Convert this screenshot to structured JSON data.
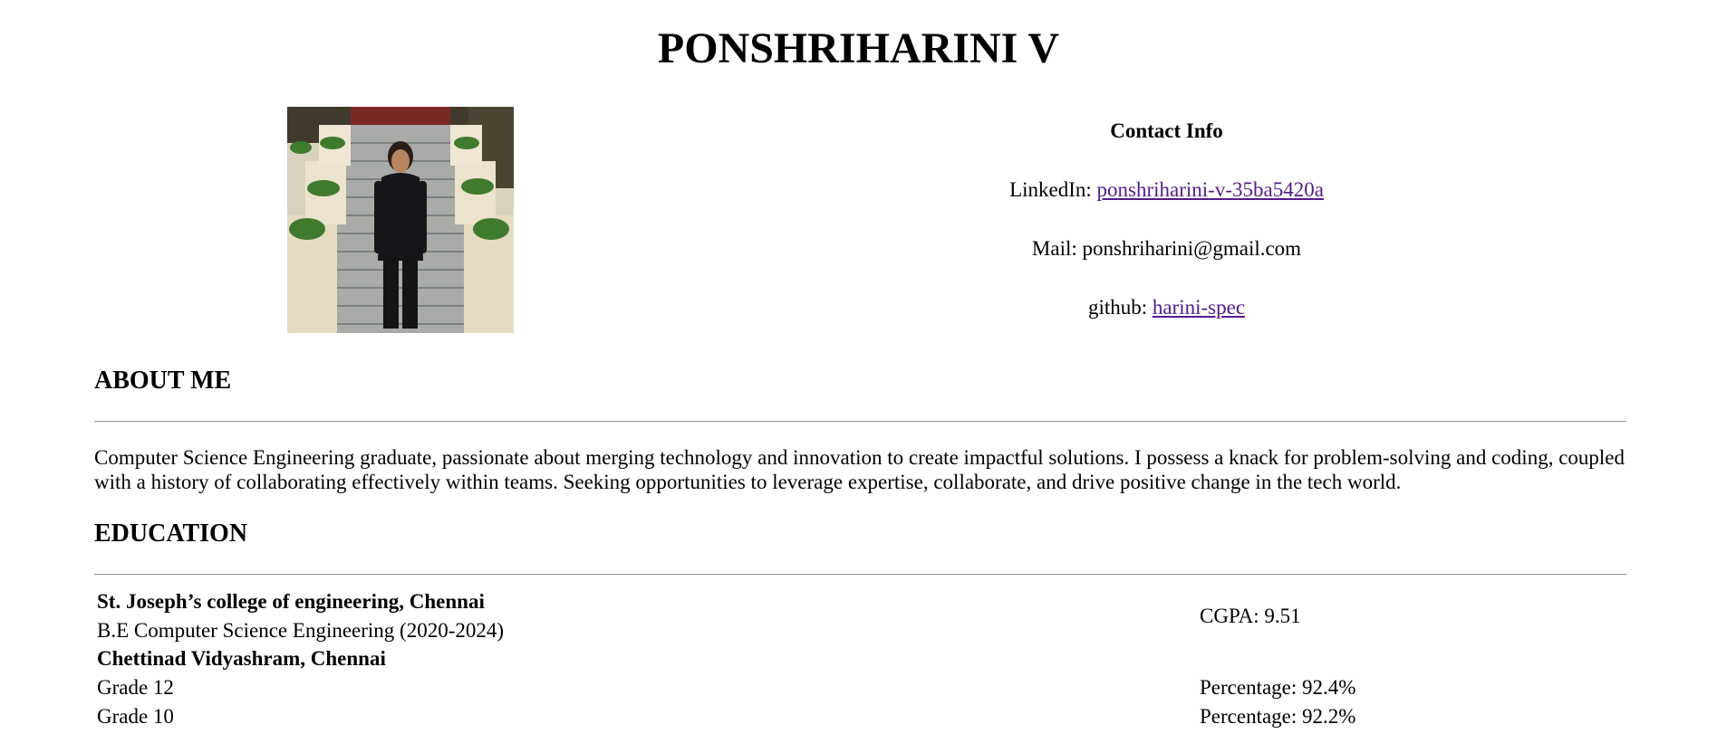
{
  "header": {
    "name": "PONSHRIHARINI V"
  },
  "photo": {
    "alt": "Profile photo"
  },
  "contact": {
    "title": "Contact Info",
    "linkedin_label": "LinkedIn:",
    "linkedin_link": "ponshriharini-v-35ba5420a",
    "mail_label": "Mail:",
    "mail_value": "ponshriharini@gmail.com",
    "github_label": "github:",
    "github_link": "harini-spec"
  },
  "about": {
    "heading": "ABOUT ME",
    "text": "Computer Science Engineering graduate, passionate about merging technology and innovation to create impactful solutions. I possess a knack for problem-solving and coding, coupled with a history of collaborating effectively within teams. Seeking opportunities to leverage expertise, collaborate, and drive positive change in the tech world."
  },
  "education": {
    "heading": "EDUCATION",
    "entries": [
      {
        "institution": "St. Joseph’s college of engineering, Chennai",
        "degree": "B.E Computer Science Engineering (2020-2024)",
        "score": "CGPA: 9.51"
      },
      {
        "institution": "Chettinad Vidyashram, Chennai",
        "grade12": "Grade 12",
        "grade12_score": "Percentage: 92.4%",
        "grade10": "Grade 10",
        "grade10_score": "Percentage: 92.2%"
      }
    ]
  },
  "colors": {
    "link": "#551a8b",
    "rule": "#9a9a9a"
  }
}
